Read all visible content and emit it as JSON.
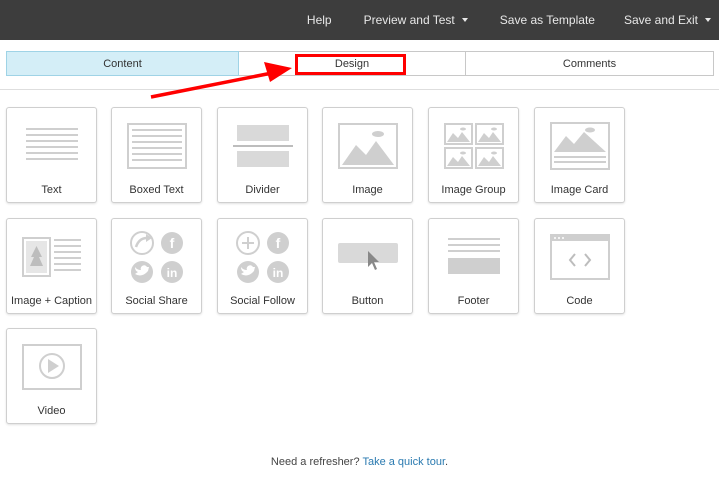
{
  "topbar": {
    "help": "Help",
    "preview": "Preview and Test",
    "save_template": "Save as Template",
    "save_exit": "Save and Exit"
  },
  "tabs": {
    "content": "Content",
    "design": "Design",
    "comments": "Comments"
  },
  "blocks": {
    "text": "Text",
    "boxed_text": "Boxed Text",
    "divider": "Divider",
    "image": "Image",
    "image_group": "Image Group",
    "image_card": "Image Card",
    "image_caption": "Image + Caption",
    "social_share": "Social Share",
    "social_follow": "Social Follow",
    "button": "Button",
    "footer": "Footer",
    "code": "Code",
    "video": "Video"
  },
  "footer": {
    "prefix": "Need a refresher?",
    "link": "Take a quick tour",
    "suffix": "."
  },
  "colors": {
    "topbar": "#3d3d3d",
    "active_tab": "#d4eef7",
    "highlight": "#ff0000",
    "icon_gray": "#cfcfcf",
    "link": "#2a7ab0"
  }
}
